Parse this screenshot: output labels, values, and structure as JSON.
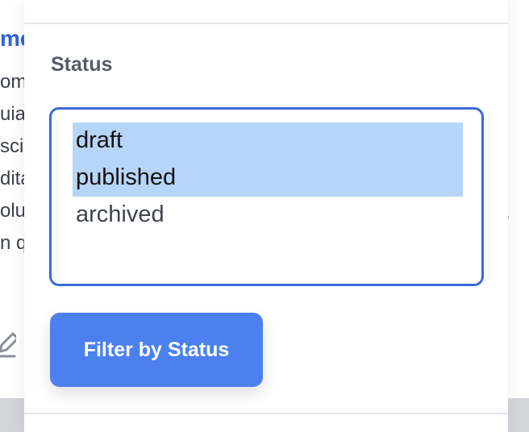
{
  "background": {
    "title_fragment": "me",
    "text_fragments": [
      "om",
      "uia",
      "sci",
      "dita",
      "olu",
      "n q"
    ],
    "trailing_dot": ".",
    "edit_icon": "pencil-square-icon"
  },
  "filter_panel": {
    "status_label": "Status",
    "status_select": {
      "options": [
        {
          "label": "draft",
          "selected": true
        },
        {
          "label": "published",
          "selected": true
        },
        {
          "label": "archived",
          "selected": false
        }
      ]
    },
    "filter_button_label": "Filter by Status"
  },
  "colors": {
    "accent": "#4b80ee",
    "select_border": "#3a6bd6",
    "selected_option_bg": "#b7d5f8",
    "label_text": "#565b66",
    "link_blue": "#2f63d9"
  }
}
